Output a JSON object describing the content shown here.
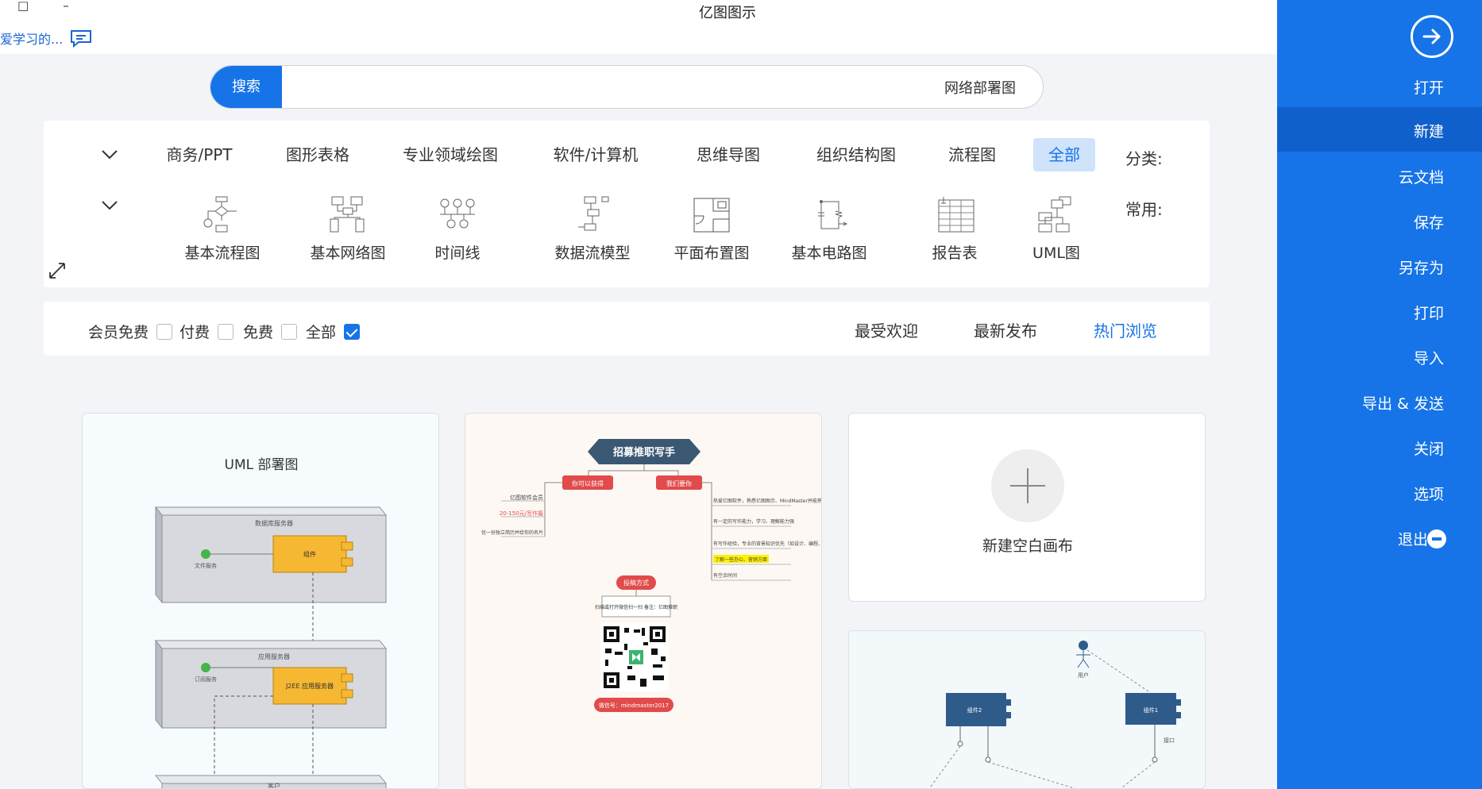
{
  "window": {
    "title": "亿图图示",
    "minimize_glyph": "–",
    "maximize_glyph": "□"
  },
  "user": {
    "name": "爱学习的..."
  },
  "sidebar": {
    "items": [
      {
        "label": "打开"
      },
      {
        "label": "新建"
      },
      {
        "label": "云文档"
      },
      {
        "label": "保存"
      },
      {
        "label": "另存为"
      },
      {
        "label": "打印"
      },
      {
        "label": "导入"
      },
      {
        "label": "导出 & 发送"
      },
      {
        "label": "关闭"
      },
      {
        "label": "选项"
      },
      {
        "label": "退出"
      }
    ],
    "active": "新建",
    "accent": "#1674e8"
  },
  "search": {
    "button_label": "搜索",
    "value": "网络部署图"
  },
  "category": {
    "label": "分类:",
    "items": [
      "全部",
      "流程图",
      "组织结构图",
      "思维导图",
      "软件/计算机",
      "专业领域绘图",
      "图形表格",
      "商务/PPT"
    ],
    "active": "全部"
  },
  "common": {
    "label": "常用:",
    "templates": [
      {
        "name": "UML图",
        "icon": "uml-icon"
      },
      {
        "name": "报告表",
        "icon": "report-table-icon"
      },
      {
        "name": "基本电路图",
        "icon": "circuit-icon"
      },
      {
        "name": "平面布置图",
        "icon": "floor-plan-icon"
      },
      {
        "name": "数据流模型",
        "icon": "data-flow-icon"
      },
      {
        "name": "时间线",
        "icon": "timeline-icon"
      },
      {
        "name": "基本网络图",
        "icon": "network-icon"
      },
      {
        "name": "基本流程图",
        "icon": "flowchart-icon"
      }
    ],
    "active": "平面布置图"
  },
  "filters": {
    "sort_tabs": [
      "热门浏览",
      "最新发布",
      "最受欢迎"
    ],
    "active_sort": "热门浏览",
    "price": [
      {
        "label": "全部",
        "checked": true
      },
      {
        "label": "免费",
        "checked": false
      },
      {
        "label": "付费",
        "checked": false
      },
      {
        "label": "会员免费",
        "checked": false
      }
    ]
  },
  "cards": {
    "new_blank": {
      "label": "新建空白画布"
    },
    "uml": {
      "title": "UML 部署图",
      "nodes": [
        "数据库服务器",
        "应用服务器",
        "客户"
      ],
      "components": [
        "组件",
        "J2EE 应用服务器"
      ],
      "ports": [
        "文件服务",
        "订阅服务"
      ]
    },
    "mind": {
      "title": "招募推职写手",
      "left_branch": "你可以获得",
      "right_branch": "我们要你",
      "left_items": [
        "亿图软件会员",
        "20-150元/写作篇",
        "优一份独立简历并给你的名片"
      ],
      "right_items": [
        "热爱亿图软件，熟悉亿图图示、MindMaster并能熟练使用",
        "有一定的写作能力，学习、理解能力强",
        "有写作经验，专业的背景知识优先（如设计、编程、办公）",
        "了解一些办公、营销方面",
        "有空余时间"
      ],
      "bottom_title": "投稿方式",
      "bottom_text": "扫描或打开微信扫一扫 备注：亿图推职",
      "wechat": "微信号：mindmaster2017"
    },
    "comp": {
      "labels": [
        "用户",
        "组件1",
        "组件2",
        "接口"
      ]
    }
  }
}
